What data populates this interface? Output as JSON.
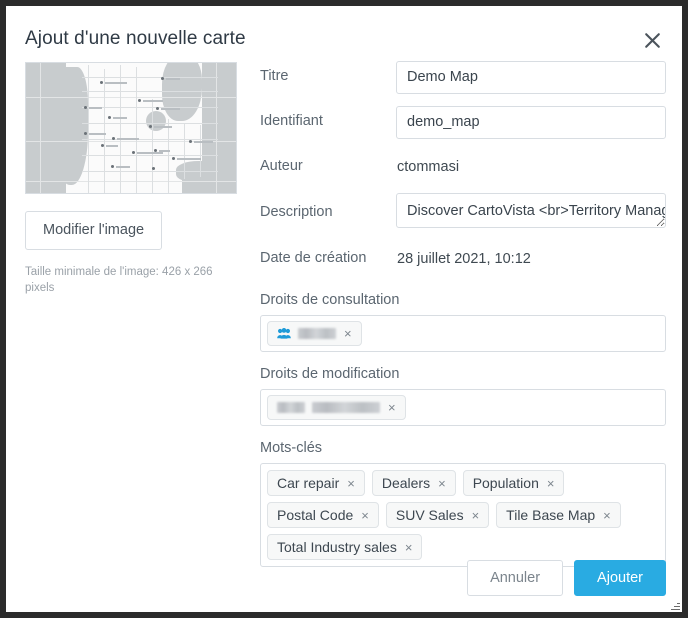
{
  "dialog": {
    "title": "Ajout d'une nouvelle carte",
    "close_icon": "close-icon"
  },
  "image_panel": {
    "thumbnail_alt": "map-thumbnail",
    "edit_image_label": "Modifier l'image",
    "min_size_hint": "Taille minimale de l'image: 426 x 266 pixels"
  },
  "fields": {
    "title": {
      "label": "Titre",
      "value": "Demo Map"
    },
    "identifier": {
      "label": "Identifiant",
      "value": "demo_map"
    },
    "author": {
      "label": "Auteur",
      "value": "ctommasi"
    },
    "description": {
      "label": "Description",
      "value": "Discover CartoVista <br>Territory Manag"
    },
    "created": {
      "label": "Date de création",
      "value": "28 juillet 2021, 10:12"
    }
  },
  "view_rights": {
    "label": "Droits de consultation",
    "chips": [
      {
        "icon": "group-icon",
        "text": "",
        "redacted": true,
        "remove_label": "×"
      }
    ]
  },
  "edit_rights": {
    "label": "Droits de modification",
    "chips": [
      {
        "icon": "",
        "text": "",
        "redacted": true,
        "remove_label": "×"
      }
    ]
  },
  "keywords": {
    "label": "Mots-clés",
    "chips": [
      {
        "text": "Car repair",
        "remove_label": "×"
      },
      {
        "text": "Dealers",
        "remove_label": "×"
      },
      {
        "text": "Population",
        "remove_label": "×"
      },
      {
        "text": "Postal Code",
        "remove_label": "×"
      },
      {
        "text": "SUV Sales",
        "remove_label": "×"
      },
      {
        "text": "Tile Base Map",
        "remove_label": "×"
      },
      {
        "text": "Total Industry sales",
        "remove_label": "×"
      }
    ]
  },
  "footer": {
    "cancel_label": "Annuler",
    "submit_label": "Ajouter"
  },
  "colors": {
    "accent": "#29abe2",
    "label_text": "#5b6670",
    "value_text": "#3f4951",
    "border": "#d8dde2",
    "hint_text": "#9aa1a8",
    "window_border": "#2b2b2b",
    "group_icon": "#1f9bd8"
  }
}
